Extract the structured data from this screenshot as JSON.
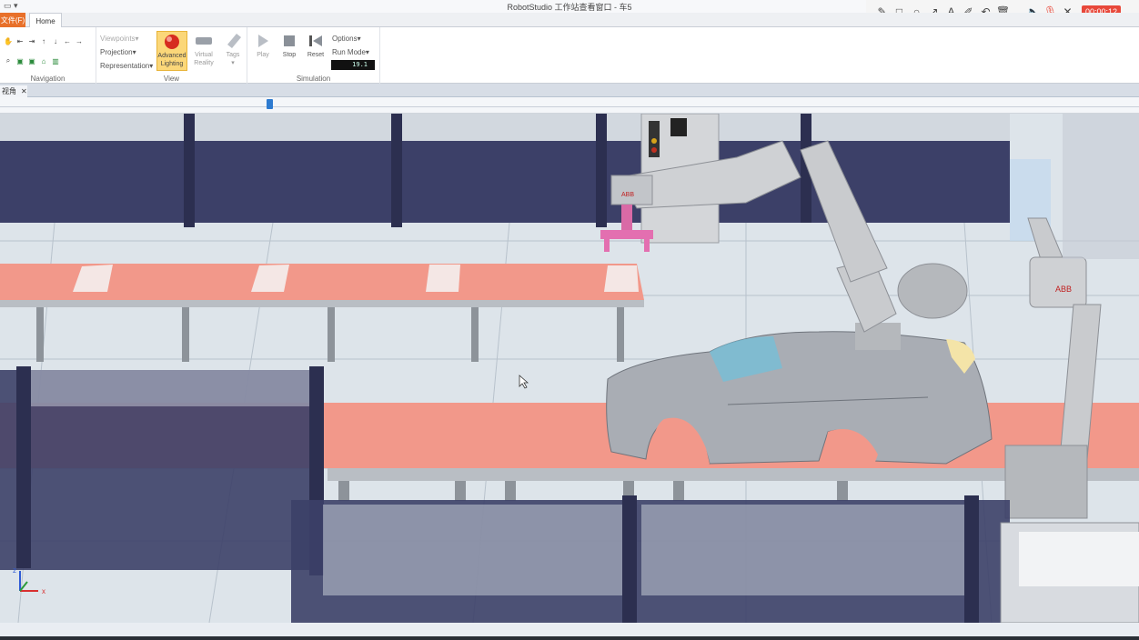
{
  "window": {
    "title": "RobotStudio 工作站查看窗口 - 车5",
    "quick_access": "▾"
  },
  "annotation_toolbar": {
    "tools": [
      "pen-icon",
      "rectangle-icon",
      "ellipse-icon",
      "arrow-icon",
      "text-icon",
      "marker-icon",
      "undo-icon",
      "trash-icon",
      "speaker-icon",
      "mic-muted-icon",
      "close-icon"
    ],
    "timer": "00:00:12"
  },
  "tabs": {
    "file": "文件(F)",
    "home": "Home"
  },
  "ribbon": {
    "navigation": {
      "label": "Navigation"
    },
    "view": {
      "label": "View",
      "viewpoints": "Viewpoints▾",
      "projection": "Projection▾",
      "representation": "Representation▾",
      "advanced_lighting_1": "Advanced",
      "advanced_lighting_2": "Lighting",
      "virtual_reality_1": "Virtual",
      "virtual_reality_2": "Reality",
      "tags": "Tags"
    },
    "simulation": {
      "label": "Simulation",
      "play": "Play",
      "stop": "Stop",
      "reset": "Reset",
      "options": "Options▾",
      "run_mode": "Run Mode▾",
      "speed": "19.1"
    }
  },
  "view_tab": {
    "label": "视角"
  },
  "timeline": {
    "position_percent": 23.4
  },
  "scene": {
    "brand_label": "ABB",
    "axes": {
      "x": "x",
      "z": "z"
    },
    "colors": {
      "conveyor": "#f2988a",
      "fence": "#3c4068",
      "floor": "#dde4ea",
      "car_body": "#a9adb4",
      "robot": "#c9cbce",
      "gripper": "#e36fb0"
    }
  }
}
